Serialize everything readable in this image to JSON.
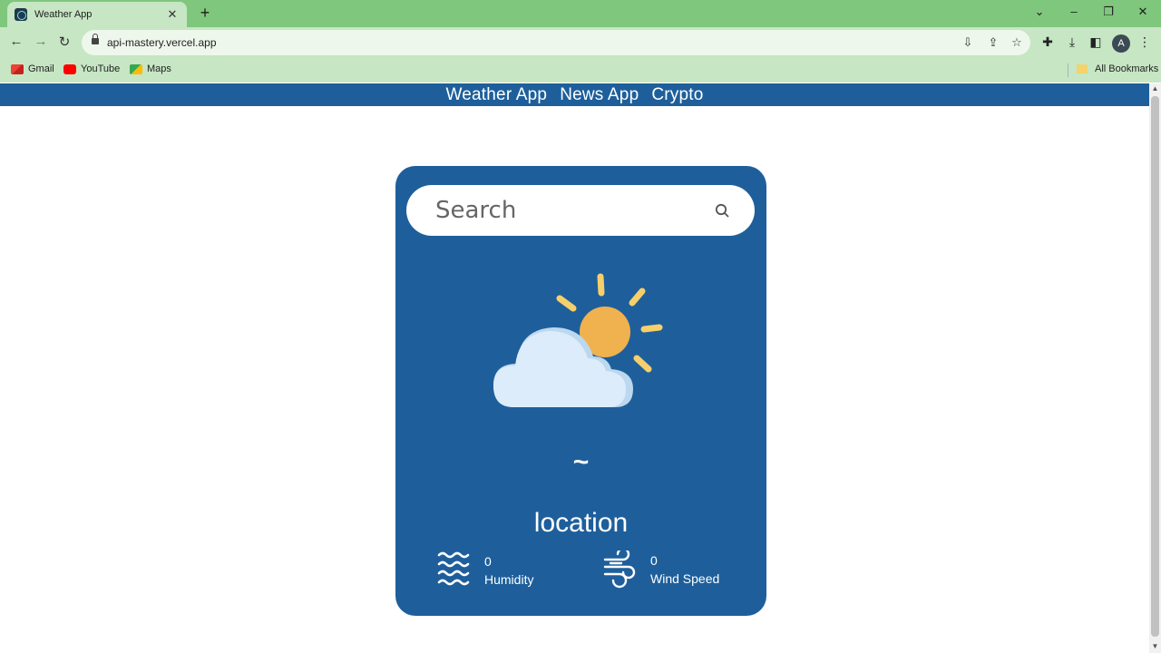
{
  "browser": {
    "tab_title": "Weather App",
    "url": "api-mastery.vercel.app",
    "avatar_letter": "A",
    "bookmarks": [
      "Gmail",
      "YouTube",
      "Maps"
    ],
    "all_bookmarks": "All Bookmarks"
  },
  "nav": {
    "links": [
      "Weather App",
      "News App",
      "Crypto"
    ]
  },
  "weather": {
    "search_placeholder": "Search",
    "temperature": "~",
    "location": "location",
    "humidity_value": "0",
    "humidity_label": "Humidity",
    "wind_value": "0",
    "wind_label": "Wind Speed"
  },
  "colors": {
    "nav_bg": "#1e5f9b",
    "card_bg": "#1e5f9b",
    "tab_strip": "#7fc77c",
    "toolbar": "#c7e6c4"
  }
}
